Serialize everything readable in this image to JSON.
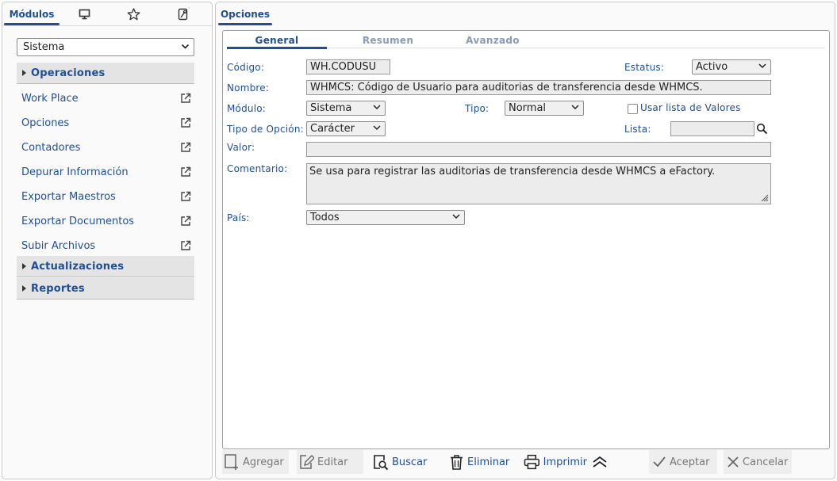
{
  "left_panel": {
    "tab_modulos": "Módulos",
    "module_select": "Sistema",
    "sections": {
      "operaciones": "Operaciones",
      "actualizaciones": "Actualizaciones",
      "reportes": "Reportes"
    },
    "items": [
      {
        "label": "Work Place"
      },
      {
        "label": "Opciones"
      },
      {
        "label": "Contadores"
      },
      {
        "label": "Depurar Información"
      },
      {
        "label": "Exportar Maestros"
      },
      {
        "label": "Exportar Documentos"
      },
      {
        "label": "Subir Archivos"
      }
    ]
  },
  "right_panel": {
    "tab_title": "Opciones",
    "subtabs": {
      "general": "General",
      "resumen": "Resumen",
      "avanzado": "Avanzado"
    },
    "form": {
      "codigo_label": "Código:",
      "codigo_value": "WH.CODUSU",
      "estatus_label": "Estatus:",
      "estatus_value": "Activo",
      "nombre_label": "Nombre:",
      "nombre_value": "WHMCS: Código de Usuario para auditorias de transferencia desde WHMCS.",
      "modulo_label": "Módulo:",
      "modulo_value": "Sistema",
      "tipo_label": "Tipo:",
      "tipo_value": "Normal",
      "usar_lista_label": "Usar lista de Valores",
      "tipo_opcion_label": "Tipo de Opción:",
      "tipo_opcion_value": "Carácter",
      "lista_label": "Lista:",
      "lista_value": "",
      "valor_label": "Valor:",
      "valor_value": "",
      "comentario_label": "Comentario:",
      "comentario_value": "Se usa para registrar las auditorias de transferencia desde WHMCS a eFactory.",
      "pais_label": "País:",
      "pais_value": "Todos"
    }
  },
  "toolbar": {
    "agregar": "Agregar",
    "editar": "Editar",
    "buscar": "Buscar",
    "eliminar": "Eliminar",
    "imprimir": "Imprimir",
    "aceptar": "Aceptar",
    "cancelar": "Cancelar"
  },
  "icons": [
    "monitor-icon",
    "star-icon",
    "tools-icon",
    "external-link-icon",
    "search-icon",
    "chevron-down-icon",
    "resize-grip-icon",
    "add-document-icon",
    "edit-icon",
    "search-document-icon",
    "trash-icon",
    "printer-icon",
    "double-chevron-up-icon",
    "check-icon",
    "close-icon"
  ],
  "colors": {
    "accent": "#1f4e96",
    "disabled_text": "#777777"
  }
}
